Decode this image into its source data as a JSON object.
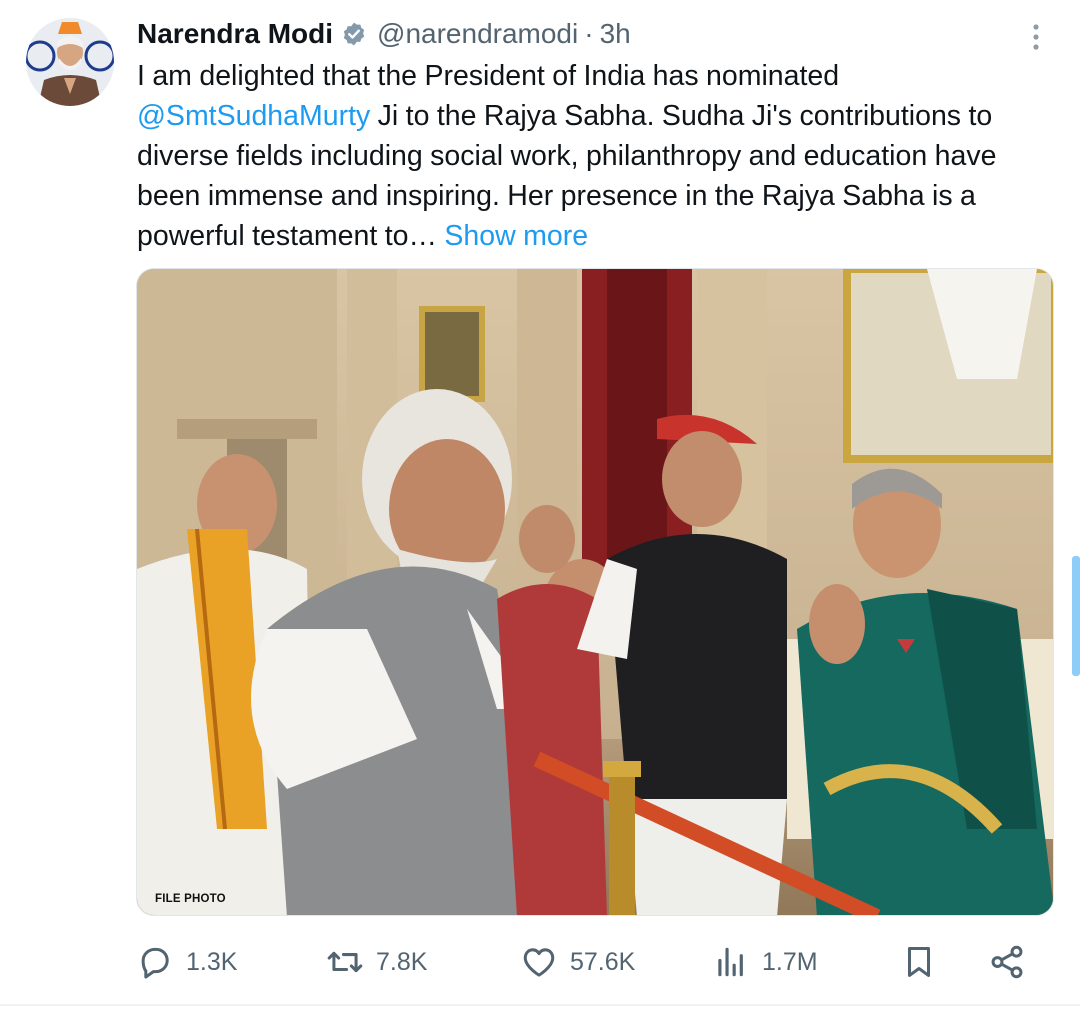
{
  "author": {
    "display_name": "Narendra Modi",
    "handle": "@narendramodi",
    "separator": "·",
    "time": "3h",
    "verified_icon": "verified-badge-icon",
    "avatar_icon": "avatar"
  },
  "tweet": {
    "text_part1": "I am delighted that the President of India has nominated ",
    "mention": "@SmtSudhaMurty",
    "text_part2": " Ji to the Rajya Sabha. Sudha Ji's contributions to diverse fields including social work, philanthropy and education have been immense and inspiring. Her presence in the Rajya Sabha is a powerful testament to… ",
    "show_more": "Show more"
  },
  "media": {
    "label": "FILE PHOTO"
  },
  "actions": {
    "replies": "1.3K",
    "reposts": "7.8K",
    "likes": "57.6K",
    "views": "1.7M"
  },
  "colors": {
    "link": "#1d9bf0",
    "secondary_text": "#536471",
    "primary_text": "#0f1419"
  },
  "icons": [
    "verified-badge-icon",
    "more-icon",
    "reply-icon",
    "repost-icon",
    "like-icon",
    "views-icon",
    "bookmark-icon",
    "share-icon"
  ]
}
